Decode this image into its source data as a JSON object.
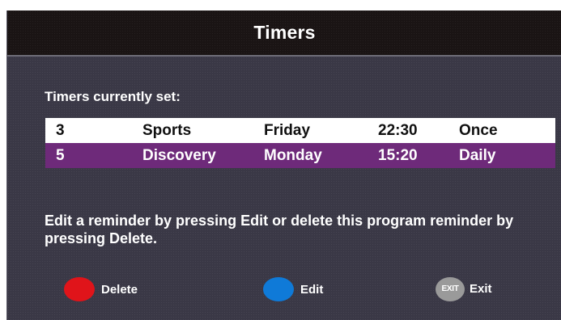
{
  "header": {
    "title": "Timers"
  },
  "main": {
    "subheading": "Timers currently set:",
    "timers": [
      {
        "number": "3",
        "channel": "Sports",
        "day": "Friday",
        "time": "22:30",
        "repeat": "Once"
      },
      {
        "number": "5",
        "channel": "Discovery",
        "day": "Monday",
        "time": "15:20",
        "repeat": "Daily"
      }
    ],
    "instructions": "Edit a reminder by pressing Edit or delete this program reminder by pressing Delete."
  },
  "footer": {
    "delete_label": "Delete",
    "edit_label": "Edit",
    "exit_key_label": "EXIT",
    "exit_label": "Exit"
  },
  "colors": {
    "background": "#3a3846",
    "title_bar": "#1a1414",
    "selected_row": "#6e2a7a",
    "delete_button": "#e0141a",
    "edit_button": "#0f7ad8",
    "exit_button": "#9a9a9a"
  },
  "icons": {
    "delete": "red-circle-icon",
    "edit": "blue-circle-icon",
    "exit": "exit-key-icon"
  }
}
